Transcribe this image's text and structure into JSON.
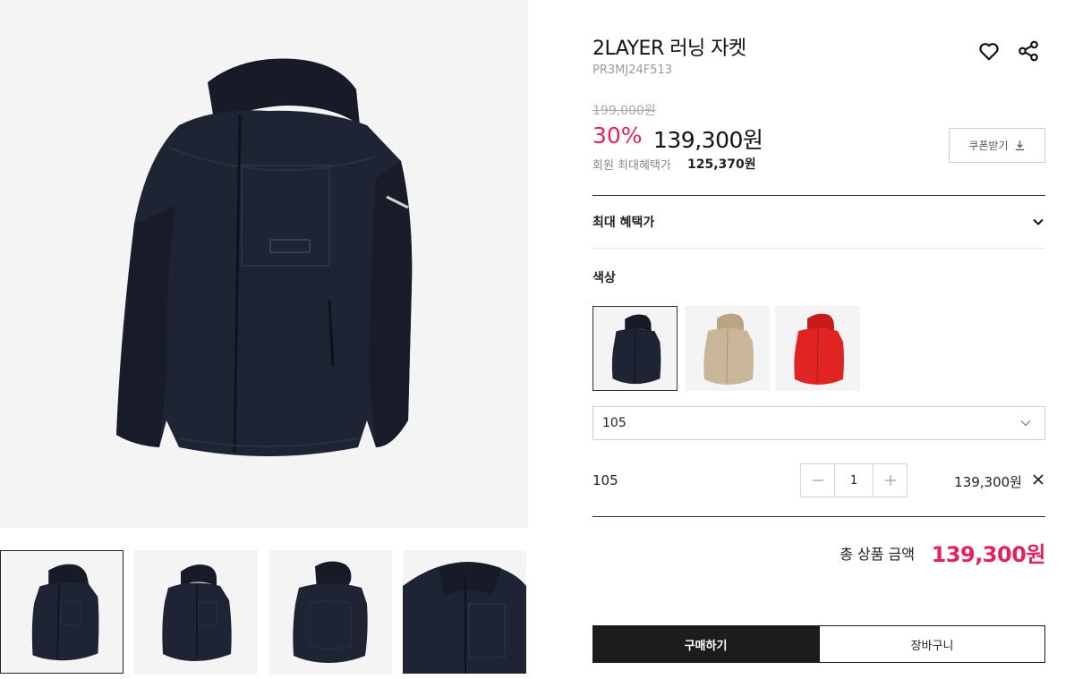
{
  "product": {
    "title": "2LAYER 러닝 자켓",
    "code": "PR3MJ24F513",
    "original_price": "199,000원",
    "discount": "30%",
    "sale_price": "139,300원",
    "member_label": "회원 최대혜택가",
    "member_price": "125,370원",
    "coupon_label": "쿠폰받기",
    "benefit_label": "최대 혜택가"
  },
  "colors": {
    "label": "색상",
    "swatches": [
      {
        "name": "navy",
        "color": "#1e2433",
        "selected": true
      },
      {
        "name": "beige",
        "color": "#c9b597",
        "selected": false
      },
      {
        "name": "red",
        "color": "#e02424",
        "selected": false
      }
    ]
  },
  "size_select": {
    "value": "105"
  },
  "selected_option": {
    "size": "105",
    "quantity": "1",
    "price": "139,300원"
  },
  "total": {
    "label": "총 상품 금액",
    "price": "139,300원"
  },
  "actions": {
    "buy": "구매하기",
    "cart": "장바구니"
  },
  "theme": {
    "accent": "#e0245e",
    "dark": "#1c1c1c",
    "jacket": "#1e2433"
  },
  "icons": [
    "heart-icon",
    "share-icon",
    "download-icon",
    "chevron-down-icon",
    "minus-icon",
    "plus-icon",
    "close-icon"
  ]
}
